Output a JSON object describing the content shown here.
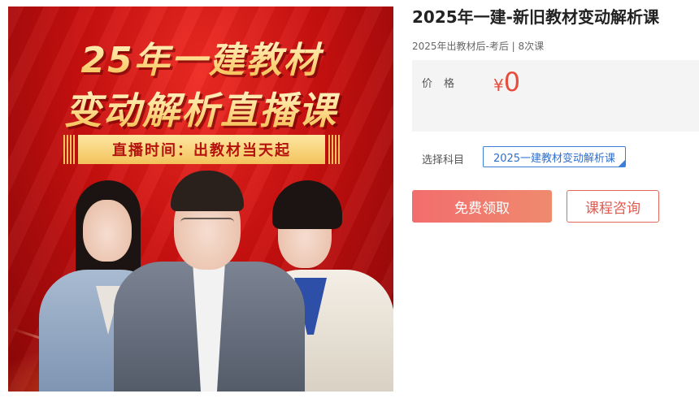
{
  "banner": {
    "line1": "25年一建教材",
    "line2": "变动解析直播课",
    "ribbon": "直播时间：出教材当天起"
  },
  "course": {
    "title": "2025年一建-新旧教材变动解析课",
    "subtitle": "2025年出教材后-考后 | 8次课"
  },
  "price": {
    "label": "价格",
    "currency": "¥",
    "amount": "0",
    "color": "#e74c3c"
  },
  "subject": {
    "label": "选择科目",
    "selected": "2025一建教材变动解析课"
  },
  "actions": {
    "free_label": "免费领取",
    "consult_label": "课程咨询"
  },
  "colors": {
    "accent": "#f26d6d",
    "select_border": "#3b7fd8"
  }
}
